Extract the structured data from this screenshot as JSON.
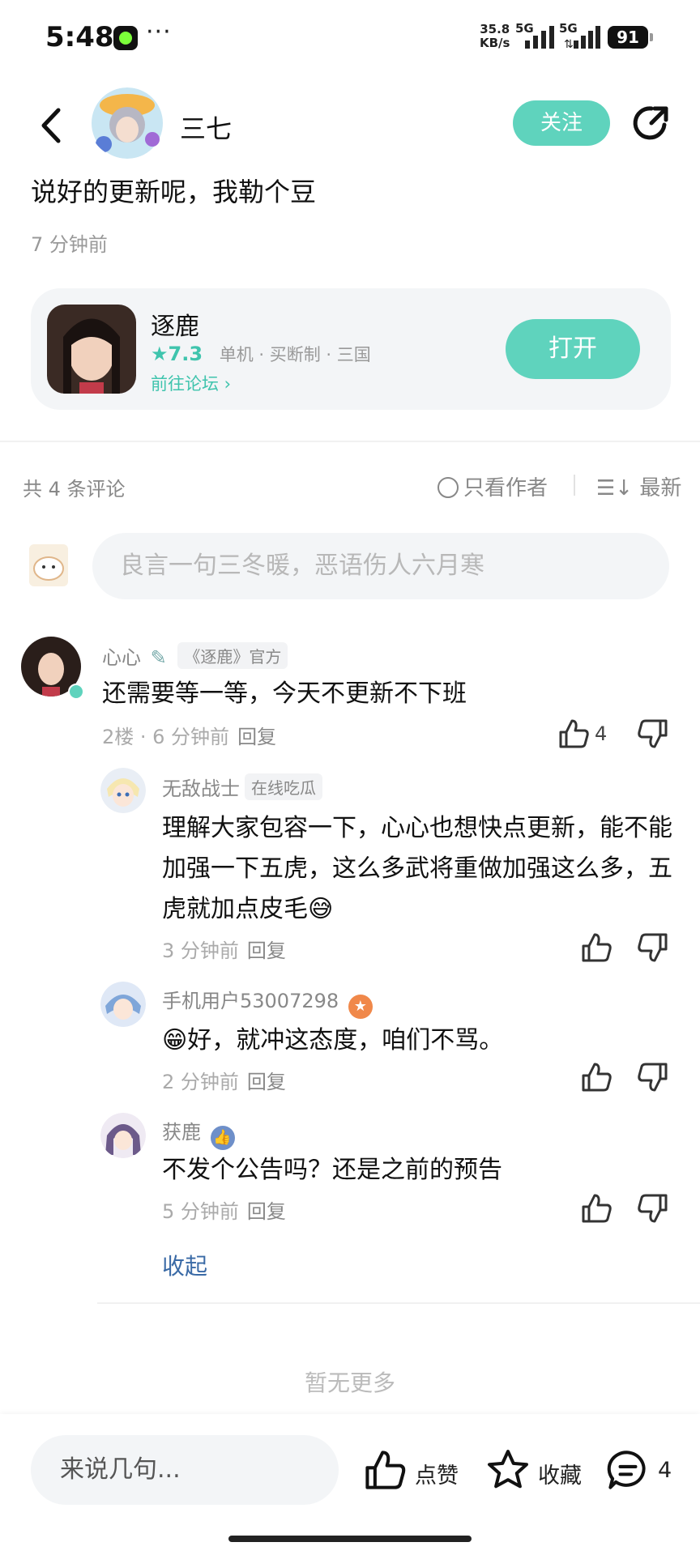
{
  "status_bar": {
    "time": "5:48",
    "more": "···",
    "net_speed_value": "35.8",
    "net_speed_unit": "KB/s",
    "signal1": "5G",
    "signal2": "5G",
    "battery": "91"
  },
  "header": {
    "user_name": "三七",
    "follow_label": "关注"
  },
  "post": {
    "title": "说好的更新呢，我勒个豆",
    "time": "7 分钟前"
  },
  "game_card": {
    "name": "逐鹿",
    "rating": "★7.3",
    "tags": "单机 · 买断制 · 三国",
    "forum_link": "前往论坛 ›",
    "open_label": "打开"
  },
  "comments_header": {
    "count": "共 4 条评论",
    "author_only": "只看作者",
    "sort": "最新"
  },
  "comment_input": {
    "placeholder": "良言一句三冬暖，恶语伤人六月寒"
  },
  "comments": [
    {
      "name": "心心",
      "tag": "《逐鹿》官方",
      "text": "还需要等一等，今天不更新不下班",
      "meta": "2楼 · 6 分钟前",
      "reply": "回复",
      "likes": "4"
    },
    {
      "name": "无敌战士",
      "tag": "在线吃瓜",
      "text": "理解大家包容一下，心心也想快点更新，能不能加强一下五虎，这么多武将重做加强这么多，五虎就加点皮毛😅",
      "meta": "3 分钟前",
      "reply": "回复"
    },
    {
      "name": "手机用户53007298",
      "text": "😁好，就冲这态度，咱们不骂。",
      "meta": "2 分钟前",
      "reply": "回复"
    },
    {
      "name": "获鹿",
      "text": "不发个公告吗？还是之前的预告",
      "meta": "5 分钟前",
      "reply": "回复"
    }
  ],
  "collapse_label": "收起",
  "no_more": "暂无更多",
  "bottom_bar": {
    "input_placeholder": "来说几句...",
    "like_label": "点赞",
    "favorite_label": "收藏",
    "comment_count": "4"
  },
  "colors": {
    "accent": "#5fd3bd",
    "link": "#3a6aa6"
  }
}
